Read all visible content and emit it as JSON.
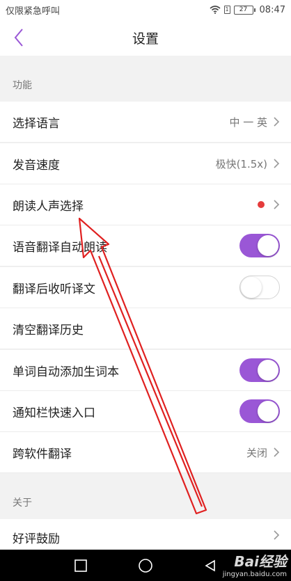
{
  "status_bar": {
    "carrier_text": "仅限紧急呼叫",
    "sim_label": "1",
    "battery": "27",
    "time": "08:47"
  },
  "header": {
    "title": "设置"
  },
  "sections": {
    "function": "功能",
    "about": "关于"
  },
  "rows": {
    "language": {
      "label": "选择语言",
      "value": "中 一 英"
    },
    "speed": {
      "label": "发音速度",
      "value": "极快(1.5x)"
    },
    "voice": {
      "label": "朗读人声选择"
    },
    "auto_read": {
      "label": "语音翻译自动朗读",
      "toggle": "on"
    },
    "listen_after": {
      "label": "翻译后收听译文",
      "toggle": "off"
    },
    "clear_history": {
      "label": "清空翻译历史"
    },
    "auto_vocab": {
      "label": "单词自动添加生词本",
      "toggle": "on"
    },
    "notification": {
      "label": "通知栏快速入口",
      "toggle": "on"
    },
    "cross_app": {
      "label": "跨软件翻译",
      "value": "关闭"
    },
    "rate": {
      "label": "好评鼓励"
    }
  },
  "watermark": {
    "main": "Bai经验",
    "sub": "jingyan.baidu.com"
  },
  "colors": {
    "accent": "#9a57d6",
    "red_dot": "#e53c3c",
    "annotation_arrow": "#e02020"
  },
  "icons": {
    "back": "chevron-left-icon",
    "chevron": "chevron-right-icon",
    "wifi": "wifi-icon",
    "nav_recent": "square-icon",
    "nav_home": "circle-icon",
    "nav_back": "triangle-icon"
  }
}
